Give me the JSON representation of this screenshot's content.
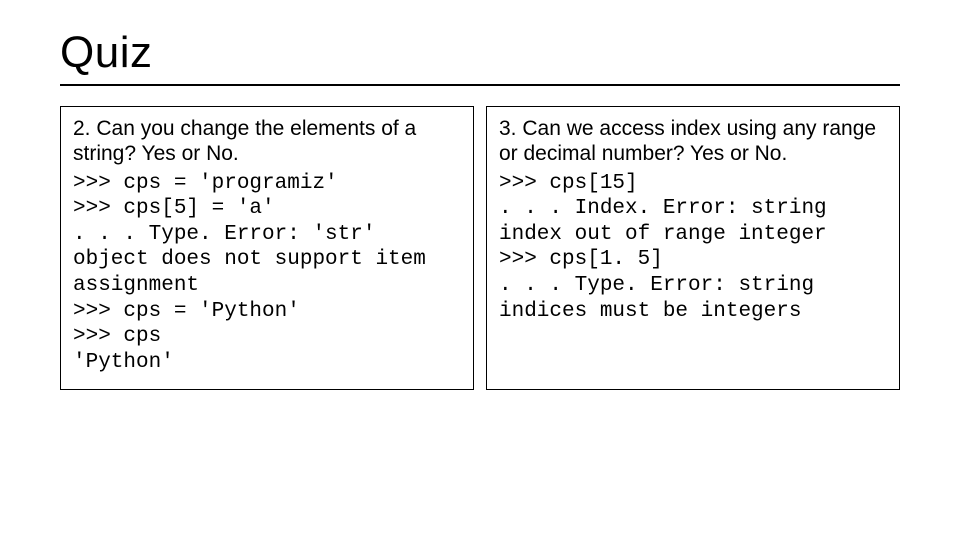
{
  "title": "Quiz",
  "left": {
    "question": "2. Can you change the elements of a string? Yes or No.",
    "code": ">>> cps = 'programiz'\n>>> cps[5] = 'a'\n. . . Type. Error: 'str' object does not support item assignment\n>>> cps = 'Python'\n>>> cps\n'Python'"
  },
  "right": {
    "question": "3. Can we access index using any range or decimal number? Yes or No.",
    "code": ">>> cps[15]\n. . . Index. Error: string index out of range integer\n>>> cps[1. 5]\n. . . Type. Error: string indices must be integers"
  }
}
